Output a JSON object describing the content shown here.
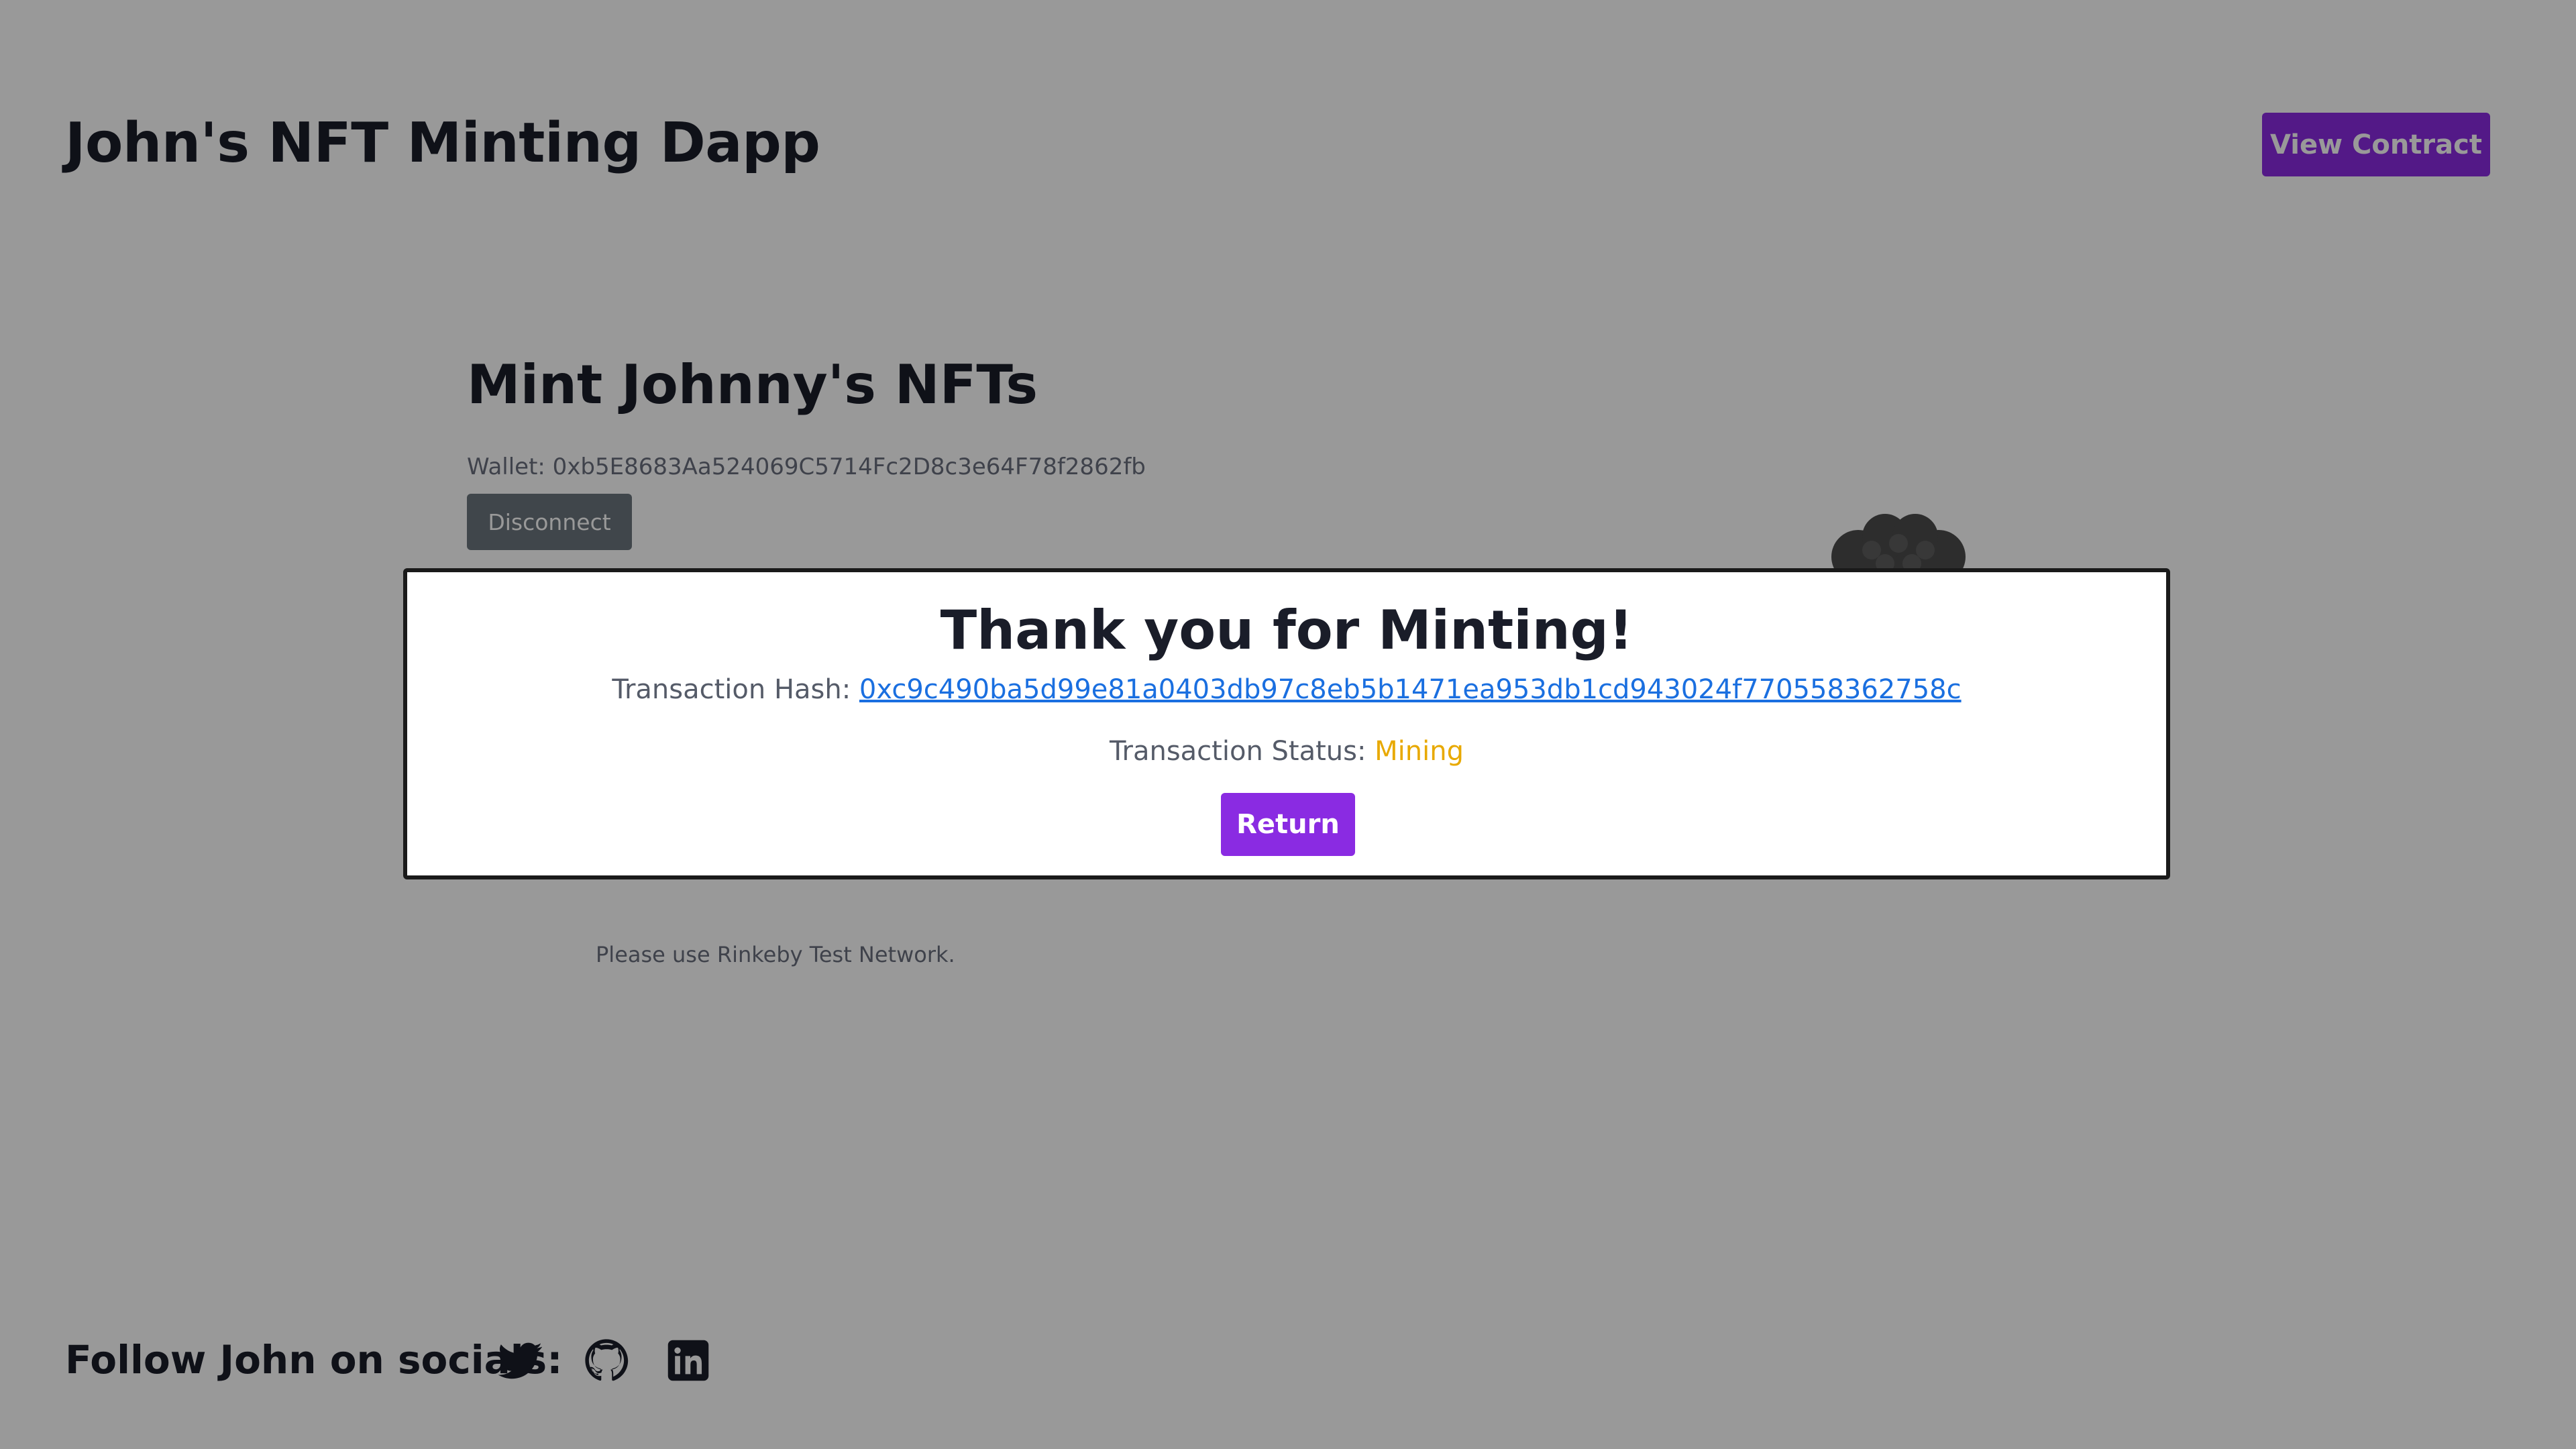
{
  "header": {
    "app_title": "John's NFT Minting Dapp",
    "view_contract_label": "View Contract"
  },
  "mint_section": {
    "heading": "Mint Johnny's NFTs",
    "wallet_text": "Wallet: 0xb5E8683Aa524069C5714Fc2D8c3e64F78f2862fb",
    "disconnect_label": "Disconnect",
    "network_note": "Please use Rinkeby Test Network."
  },
  "footer": {
    "socials_label": "Follow John on socials:",
    "icons": [
      "twitter-icon",
      "github-icon",
      "linkedin-icon"
    ]
  },
  "modal": {
    "title": "Thank you for Minting!",
    "hash_label": "Transaction Hash: ",
    "hash_value": "0xc9c490ba5d99e81a0403db97c8eb5b1471ea953db1cd943024f770558362758c",
    "status_label": "Transaction Status: ",
    "status_value": "Mining",
    "return_label": "Return"
  },
  "colors": {
    "accent": "#8a2be2",
    "link": "#1a6fe0",
    "status_pending": "#e8a900",
    "overlay": "rgba(0,0,0,0.40)"
  }
}
